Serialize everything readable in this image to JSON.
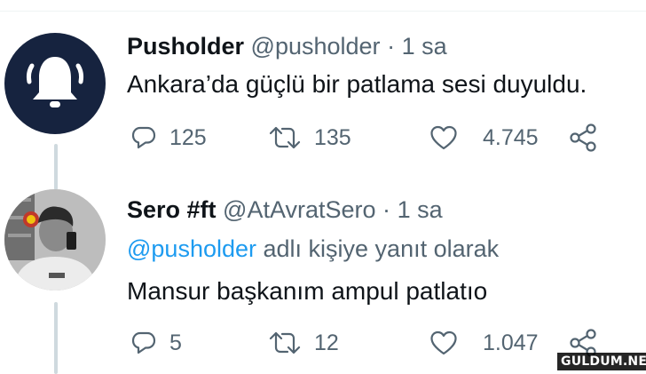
{
  "tweets": [
    {
      "author": "Pusholder",
      "handle": "@pusholder",
      "separator": "·",
      "time": "1 sa",
      "text": "Ankara’da güçlü bir patlama sesi duyuldu.",
      "replies": "125",
      "retweets": "135",
      "likes": "4.745",
      "avatar_icon": "bell-icon"
    },
    {
      "author": "Sero #ft",
      "handle": "@AtAvratSero",
      "separator": "·",
      "time": "1 sa",
      "reply_mention": "@pusholder",
      "reply_suffix": " adlı kişiye yanıt olarak",
      "text": "Mansur başkanım ampul patlatıo",
      "replies": "5",
      "retweets": "12",
      "likes": "1.047"
    }
  ],
  "watermark": "GULDUM.NET",
  "colors": {
    "text": "#0f1419",
    "muted": "#536471",
    "link": "#1d9bf0",
    "thread_line": "#cfd9de",
    "avatar_bg": "#16233f"
  }
}
